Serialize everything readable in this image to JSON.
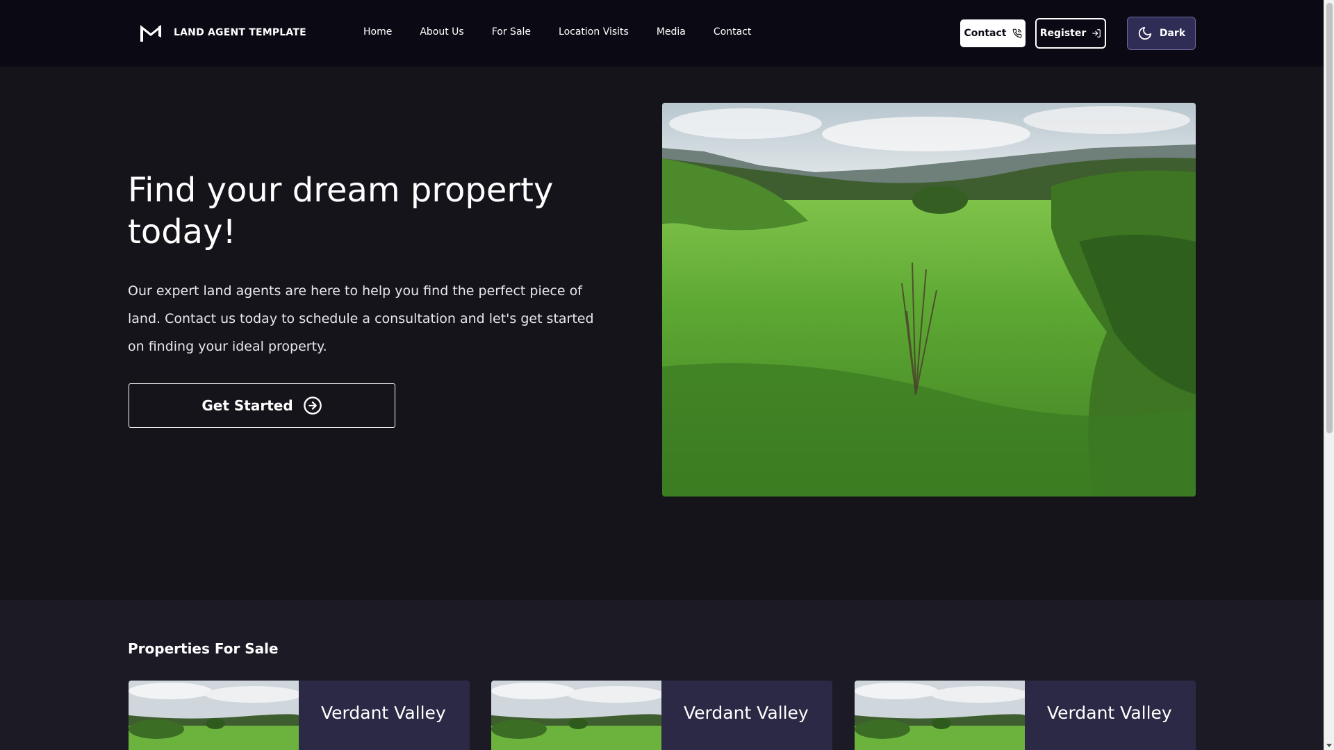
{
  "brand": {
    "name": "LAND AGENT TEMPLATE",
    "icon": "flag-logo-icon"
  },
  "nav": {
    "items": [
      {
        "label": "Home"
      },
      {
        "label": "About Us"
      },
      {
        "label": "For Sale"
      },
      {
        "label": "Location Visits"
      },
      {
        "label": "Media"
      },
      {
        "label": "Contact"
      }
    ]
  },
  "header_actions": {
    "contact_label": "Contact",
    "contact_icon": "phone-icon",
    "register_label": "Register",
    "register_icon": "login-arrow-icon",
    "theme_label": "Dark",
    "theme_icon": "moon-icon"
  },
  "hero": {
    "title": "Find your dream property today!",
    "text": "Our expert land agents are here to help you find the perfect piece of land. Contact us today to schedule a consultation and let's get started on finding your ideal property.",
    "cta_label": "Get Started",
    "cta_icon": "arrow-right-circle-icon"
  },
  "properties": {
    "title": "Properties For Sale",
    "cards": [
      {
        "title": "Verdant Valley"
      },
      {
        "title": "Verdant Valley"
      },
      {
        "title": "Verdant Valley"
      }
    ]
  },
  "colors": {
    "background": "#15141b",
    "header": "#0b0a14",
    "card": "#2c2946",
    "theme_button": "#2f2c55"
  }
}
